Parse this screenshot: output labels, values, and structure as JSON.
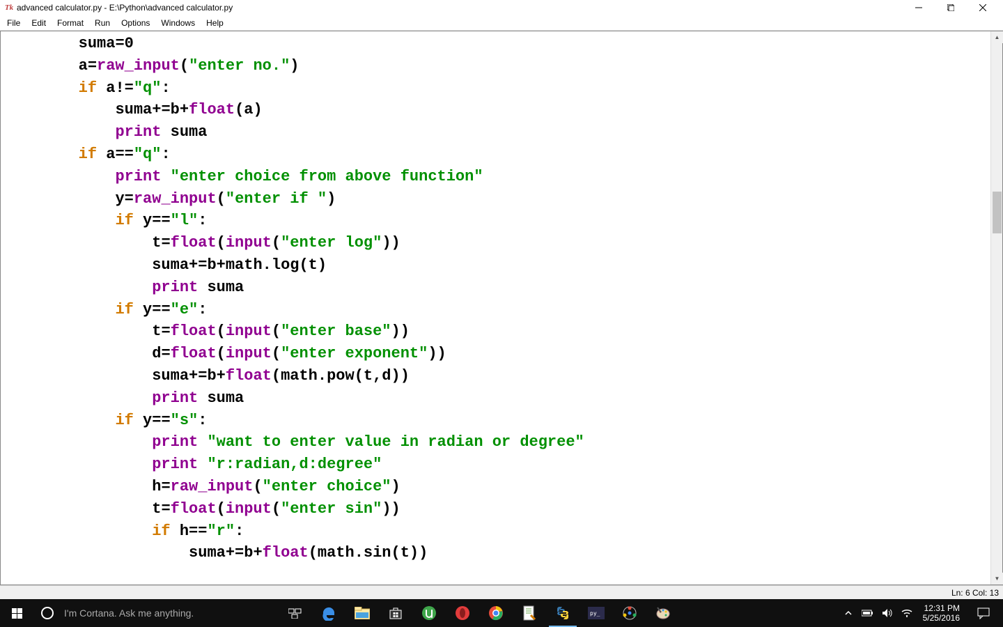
{
  "titlebar": {
    "icon_label": "Tk",
    "title": "advanced calculator.py - E:\\Python\\advanced calculator.py"
  },
  "menubar": {
    "items": [
      "File",
      "Edit",
      "Format",
      "Run",
      "Options",
      "Windows",
      "Help"
    ]
  },
  "code": {
    "t_suma": "suma",
    "t_eq": "=",
    "t_zero": "0",
    "t_a": "a",
    "t_raw_input": "raw_input",
    "t_lp": "(",
    "t_rp": ")",
    "t_str_enter_no": "\"enter no.\"",
    "t_if": "if",
    "t_neq": "!=",
    "t_str_q": "\"q\"",
    "t_colon": ":",
    "t_pluseq": "+=",
    "t_b": "b",
    "t_plus": "+",
    "t_float": "float",
    "t_print": "print",
    "t_eqeq": "==",
    "t_str_choice": "\"enter choice from above function\"",
    "t_y": "y",
    "t_str_enter_if": "\"enter if \"",
    "t_str_l": "\"l\"",
    "t_t": "t",
    "t_input": "input",
    "t_str_enter_log": "\"enter log\"",
    "t_mathlog": "math.log(t)",
    "t_str_e": "\"e\"",
    "t_str_enter_base": "\"enter base\"",
    "t_d": "d",
    "t_str_enter_exp": "\"enter exponent\"",
    "t_mathpow": "(math.pow(t,d))",
    "t_str_s": "\"s\"",
    "t_str_rad_deg": "\"want to enter value in radian or degree\"",
    "t_str_rd": "\"r:radian,d:degree\"",
    "t_h": "h",
    "t_str_enter_choice": "\"enter choice\"",
    "t_str_enter_sin": "\"enter sin\"",
    "t_str_r": "\"r\"",
    "t_mathsin": "(math.sin(t))"
  },
  "statusbar": {
    "position": "Ln: 6 Col: 13"
  },
  "taskbar": {
    "search_placeholder": "I'm Cortana. Ask me anything.",
    "clock_time": "12:31 PM",
    "clock_date": "5/25/2016"
  }
}
